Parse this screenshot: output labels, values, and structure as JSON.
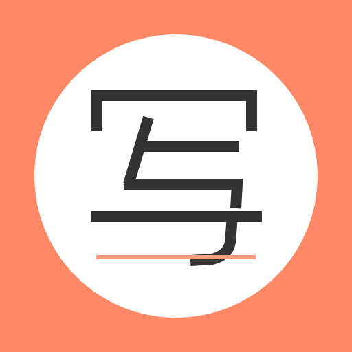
{
  "icon": {
    "semantic": "write-character-icon",
    "character": "写",
    "colors": {
      "background": "#ff8866",
      "circle": "#ffffff",
      "glyph": "#333333",
      "underline": "#ff9a80"
    }
  }
}
